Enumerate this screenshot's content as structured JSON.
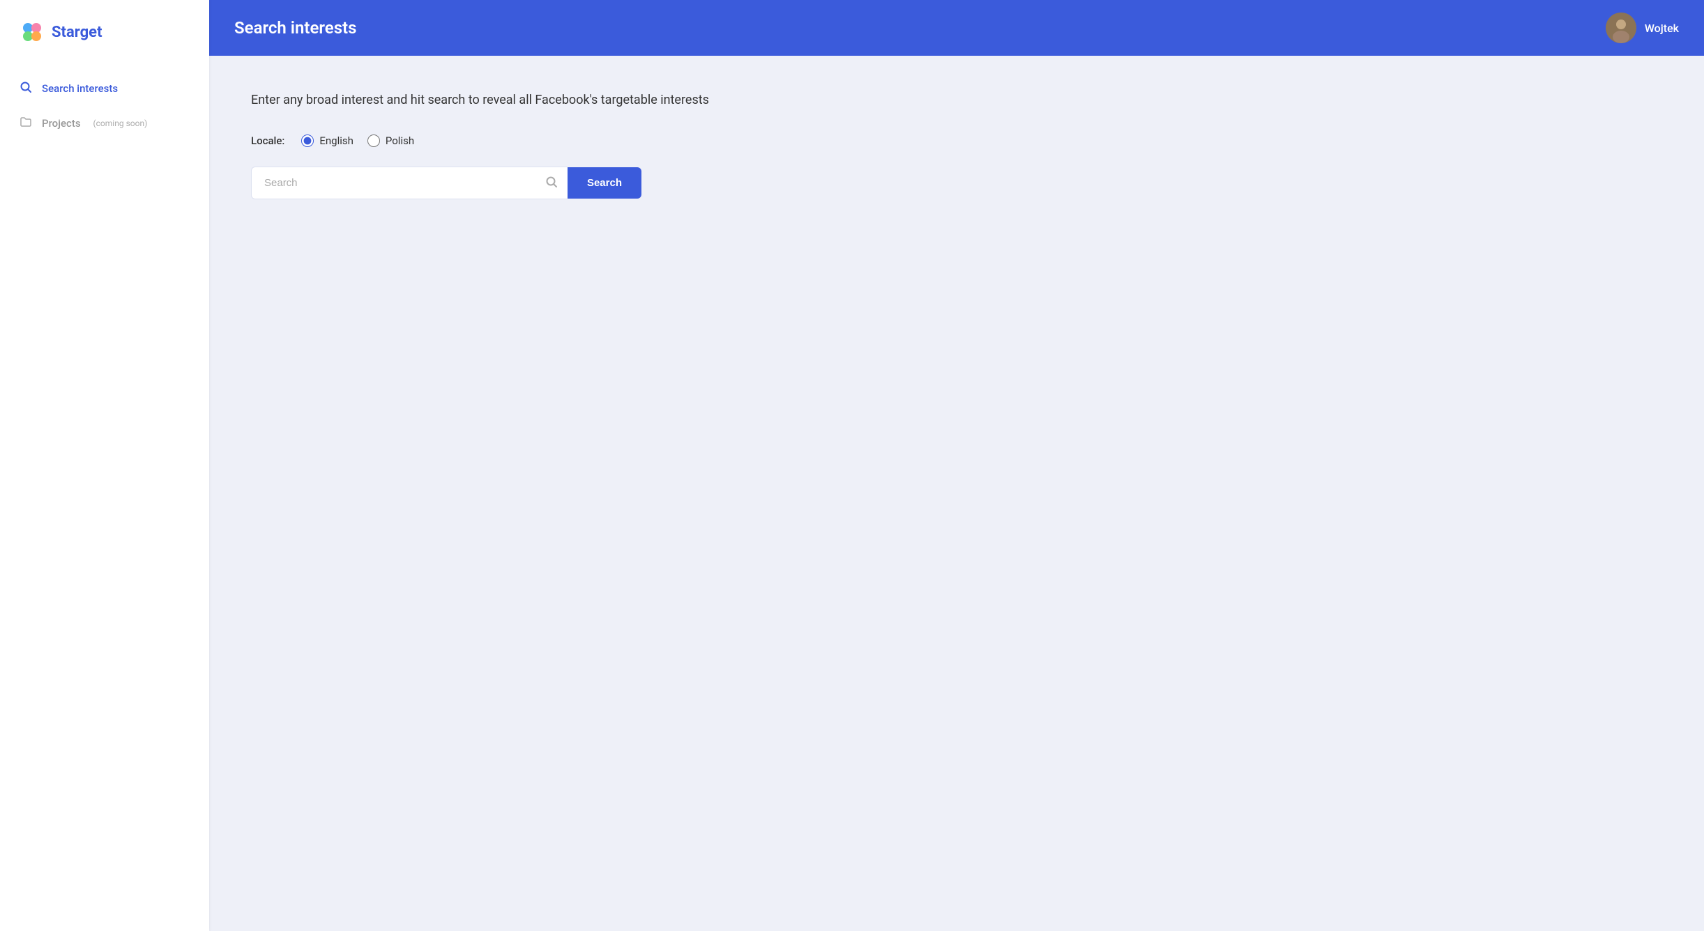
{
  "logo": {
    "text": "Starget"
  },
  "sidebar": {
    "items": [
      {
        "id": "search-interests",
        "label": "Search interests",
        "icon": "search",
        "active": true,
        "coming_soon": ""
      },
      {
        "id": "projects",
        "label": "Projects",
        "icon": "folder",
        "active": false,
        "coming_soon": "(coming soon)"
      }
    ]
  },
  "header": {
    "title": "Search interests",
    "user": {
      "name": "Wojtek"
    }
  },
  "main": {
    "description": "Enter any broad interest and hit search to reveal all Facebook's targetable interests",
    "locale": {
      "label": "Locale:",
      "options": [
        {
          "value": "english",
          "label": "English",
          "checked": true
        },
        {
          "value": "polish",
          "label": "Polish",
          "checked": false
        }
      ]
    },
    "search": {
      "placeholder": "Search",
      "button_label": "Search"
    }
  }
}
